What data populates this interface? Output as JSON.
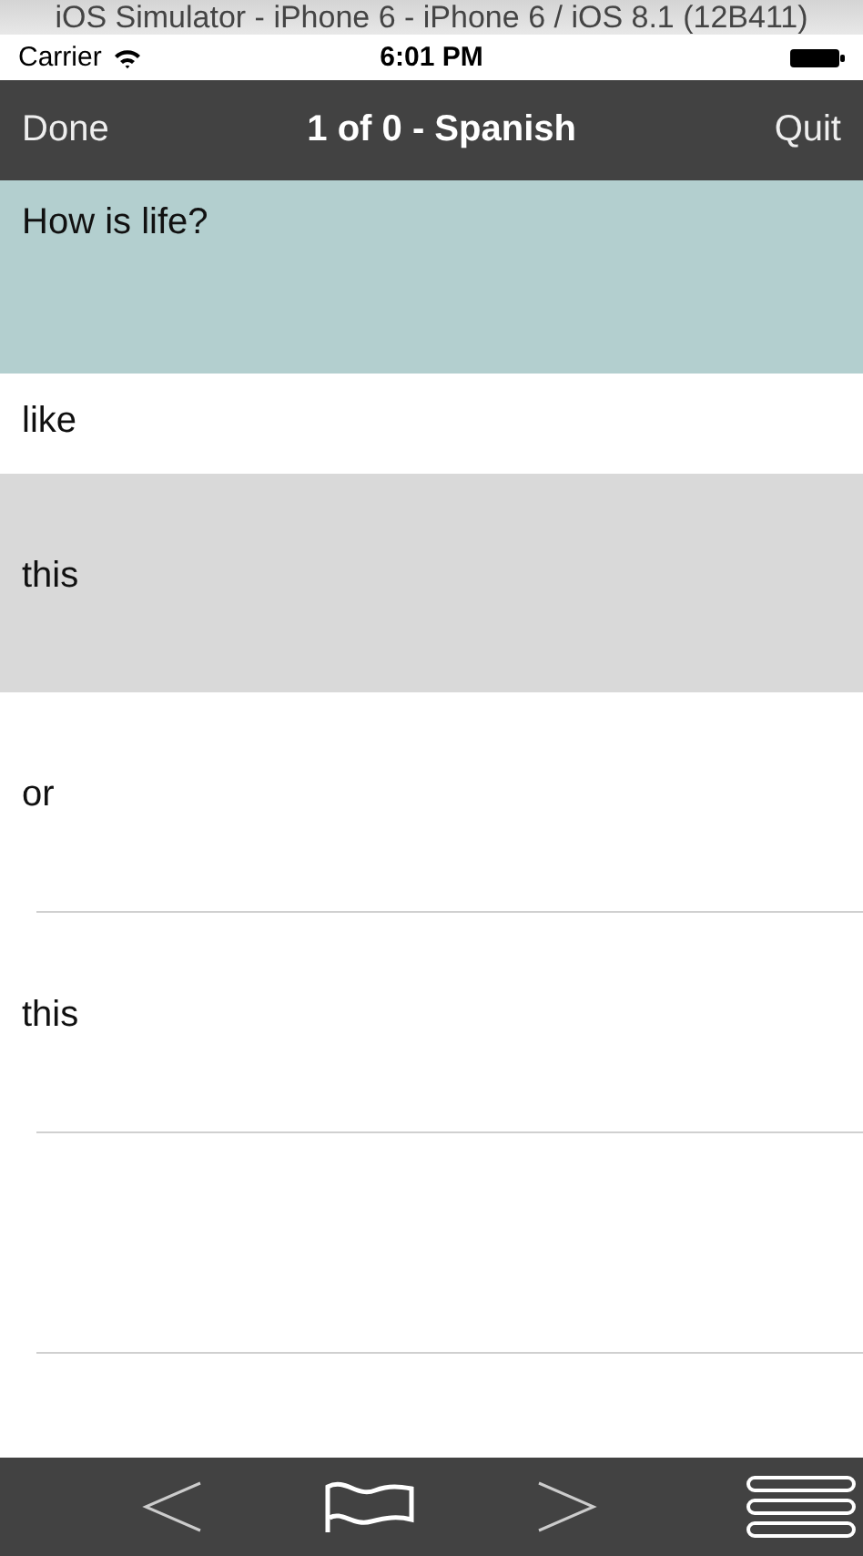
{
  "window": {
    "title": "iOS Simulator - iPhone 6 - iPhone 6 / iOS 8.1 (12B411)"
  },
  "status_bar": {
    "carrier": "Carrier",
    "time": "6:01 PM"
  },
  "nav_bar": {
    "left_button": "Done",
    "title": "1 of 0 - Spanish",
    "right_button": "Quit"
  },
  "question": "How is life?",
  "answers": [
    {
      "text": "like",
      "selected": false
    },
    {
      "text": "this",
      "selected": true
    },
    {
      "text": "or",
      "selected": false
    },
    {
      "text": "this",
      "selected": false
    }
  ],
  "toolbar": {
    "items": [
      {
        "kind": "back"
      },
      {
        "kind": "flag"
      },
      {
        "kind": "forward"
      },
      {
        "kind": "menu"
      }
    ]
  }
}
